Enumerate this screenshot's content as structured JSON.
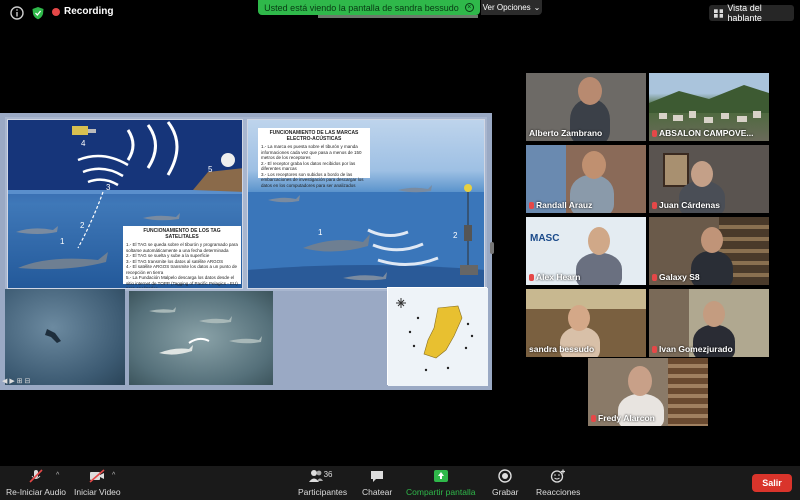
{
  "top_bar": {
    "recording_label": "Recording",
    "share_banner_text": "Usted está viendo la pantalla de sandra bessudo",
    "view_options_label": "Ver Opciones",
    "speaker_view_label": "Vista del hablante"
  },
  "shared_screen": {
    "satellite_box_title": "FUNCIONAMIENTO DE LOS TAG SATELITALES",
    "satellite_box_lines": [
      "1.- El TAG se queda sobre el tiburón y programado para soltarse automáticamente a una fecha determinada",
      "2.- El TAG se suelta y sube a la superficie",
      "3.- El TAG transmite los datos al satélite ARGOS",
      "4.- El satélite ARGOS transmite los datos a un punto de recepción en tierra",
      "5.- La Fundación Malpelo descarga los datos desde el sitio internet de TOPP (Tagging of Pacific Pelagics - EU) para analizarlos"
    ],
    "acoustic_box_title": "FUNCIONAMIENTO DE LAS MARCAS ELECTRO-ACÚSTICAS",
    "acoustic_box_lines": [
      "1.- La marca es puesta sobre el tiburón y manda informaciones cada vez que pasa a menos de 150 metros de los receptores",
      "2.- El receptor graba los datos recibidos por las diferentes marcas",
      "3.- Los receptores son subidos a bordo de las embarcaciones de investigación para descargar los datos en los computadores para ser analizados"
    ],
    "numbers": [
      "1",
      "2",
      "3",
      "4",
      "5"
    ]
  },
  "participants": [
    {
      "name": "Alberto Zambrano",
      "muted": false
    },
    {
      "name": "ABSALON CAMPOVE...",
      "muted": true
    },
    {
      "name": "Randall Arauz",
      "muted": true
    },
    {
      "name": "Juan Cárdenas",
      "muted": true
    },
    {
      "name": "Alex Hearn",
      "muted": true
    },
    {
      "name": "Galaxy S8",
      "muted": true
    },
    {
      "name": "sandra bessudo",
      "muted": false
    },
    {
      "name": "Ivan Gomezjurado",
      "muted": true
    },
    {
      "name": "Fredy Alarcon",
      "muted": true
    }
  ],
  "tile_logo_text": "MASC",
  "toolbar": {
    "audio_label": "Re-Iniciar Audio",
    "video_label": "Iniciar Video",
    "participants_label": "Participantes",
    "participants_count": "36",
    "chat_label": "Chatear",
    "share_label": "Compartir pantalla",
    "record_label": "Grabar",
    "reactions_label": "Reacciones",
    "leave_label": "Salir"
  },
  "colors": {
    "share_green": "#2fb84a",
    "leave_red": "#d9342b",
    "muted_red": "#e54848"
  }
}
